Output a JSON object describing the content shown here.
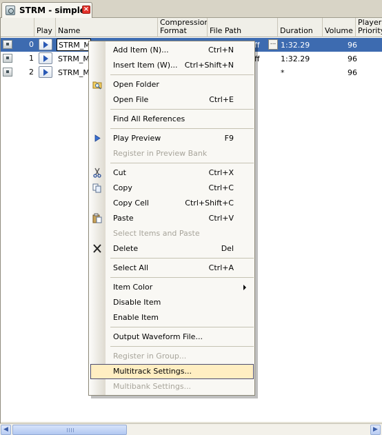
{
  "tab": {
    "title": "STRM - simple",
    "close_glyph": "×"
  },
  "columns": [
    {
      "label": "Play"
    },
    {
      "label": "Name"
    },
    {
      "label": "Compression Format"
    },
    {
      "label": "File Path"
    },
    {
      "label": "Duration"
    },
    {
      "label": "Volume"
    },
    {
      "label": "Player Priority"
    }
  ],
  "rows": [
    {
      "index": "0",
      "name": "STRM_M",
      "file_path_tail": "ff",
      "ellipsis": "...",
      "duration": "1:32.29",
      "volume": "96",
      "selected": true
    },
    {
      "index": "1",
      "name": "STRM_M",
      "file_path_tail": "ff",
      "duration": "1:32.29",
      "volume": "96",
      "selected": false
    },
    {
      "index": "2",
      "name": "STRM_M",
      "duration": "*",
      "volume": "96",
      "selected": false
    }
  ],
  "context_menu": {
    "items": {
      "add_item": {
        "label": "Add Item (N)...",
        "shortcut": "Ctrl+N"
      },
      "insert_item": {
        "label": "Insert Item (W)...",
        "shortcut": "Ctrl+Shift+N"
      },
      "open_folder": {
        "label": "Open Folder",
        "icon": "folder-search-icon"
      },
      "open_file": {
        "label": "Open File",
        "shortcut": "Ctrl+E"
      },
      "find_all_references": {
        "label": "Find All References"
      },
      "play_preview": {
        "label": "Play Preview",
        "shortcut": "F9",
        "icon": "play-icon"
      },
      "register_in_preview_bank": {
        "label": "Register in Preview Bank",
        "disabled": true
      },
      "cut": {
        "label": "Cut",
        "shortcut": "Ctrl+X",
        "icon": "scissors-icon"
      },
      "copy": {
        "label": "Copy",
        "shortcut": "Ctrl+C",
        "icon": "copy-icon"
      },
      "copy_cell": {
        "label": "Copy Cell",
        "shortcut": "Ctrl+Shift+C"
      },
      "paste": {
        "label": "Paste",
        "shortcut": "Ctrl+V",
        "icon": "paste-icon"
      },
      "select_items_and_paste": {
        "label": "Select Items and Paste",
        "disabled": true
      },
      "delete": {
        "label": "Delete",
        "shortcut": "Del",
        "icon": "delete-x-icon"
      },
      "select_all": {
        "label": "Select All",
        "shortcut": "Ctrl+A"
      },
      "item_color": {
        "label": "Item Color",
        "has_submenu": true
      },
      "disable_item": {
        "label": "Disable Item"
      },
      "enable_item": {
        "label": "Enable Item"
      },
      "output_waveform_file": {
        "label": "Output Waveform File..."
      },
      "register_in_group": {
        "label": "Register in Group...",
        "disabled": true
      },
      "multitrack_settings": {
        "label": "Multitrack Settings...",
        "hovered": true
      },
      "multibank_settings": {
        "label": "Multibank Settings...",
        "disabled": true
      }
    }
  },
  "scrollbar": {
    "left_arrow": "◀",
    "right_arrow": "▶"
  },
  "colors": {
    "selection": "#3d6bb0",
    "menu_hover_fill": "#ffeec2",
    "menu_hover_border": "#4b4b6f",
    "disabled_text": "#a7a49a"
  }
}
